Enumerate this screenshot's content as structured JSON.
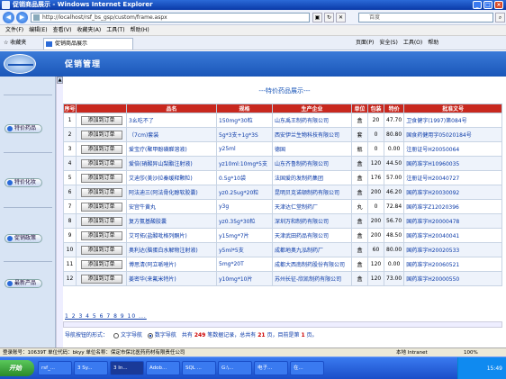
{
  "window": {
    "title": "促销商品展示 - Windows Internet Explorer"
  },
  "address": {
    "url": "http://localhost/rsf_bs_gsp/custom/frame.aspx",
    "search_placeholder": "百度"
  },
  "menu": [
    "文件(F)",
    "编辑(E)",
    "查看(V)",
    "收藏夹(A)",
    "工具(T)",
    "帮助(H)"
  ],
  "favbar": {
    "favorites": "收藏夹",
    "tab": "促销商品展示",
    "tools": [
      "页面(P)",
      "安全(S)",
      "工具(O)",
      "帮助"
    ]
  },
  "app": {
    "title": "促销管理"
  },
  "sidebar": [
    {
      "label": "特价药品"
    },
    {
      "label": "特价化妆"
    },
    {
      "label": "促销政策"
    },
    {
      "label": "最新产品"
    }
  ],
  "page": {
    "title": "---特价药品展示---"
  },
  "table": {
    "headers": [
      "序号",
      "",
      "品名",
      "规格",
      "生产企业",
      "单位",
      "包装",
      "特价",
      "批准文号"
    ],
    "order_label": "添加到订单",
    "rows": [
      {
        "no": "1",
        "name": "3幺吃不了",
        "spec": "150mg*30粒",
        "maker": "山东禹王制药有限公司",
        "unit": "盒",
        "pack": "20",
        "price": "47.70",
        "approval": "卫食健字(1997)第084号"
      },
      {
        "no": "2",
        "name": "（7cm)套装",
        "spec": "5g*3支+1g*3S",
        "maker": "西安伊兰生物科技有限公司",
        "unit": "套",
        "pack": "0",
        "price": "80.80",
        "approval": "国食药健用字05020184号"
      },
      {
        "no": "3",
        "name": "爱宝疗(聚甲酚磺醛溶液)",
        "spec": "y25ml",
        "maker": "德国",
        "unit": "瓶",
        "pack": "0",
        "price": "0.00",
        "approval": "注册证号H20050064"
      },
      {
        "no": "4",
        "name": "爱倍(硝酸异山梨酯注射液)",
        "spec": "yz10ml:10mg*5支",
        "maker": "山东齐鲁制药有限公司",
        "unit": "盒",
        "pack": "120",
        "price": "44.50",
        "approval": "国药准字H10960035"
      },
      {
        "no": "5",
        "name": "艾迪莎(美沙拉秦缓释颗粒)",
        "spec": "0.5g*10袋",
        "maker": "法国爱的发制药集团",
        "unit": "盒",
        "pack": "176",
        "price": "57.00",
        "approval": "注册证号H20040727"
      },
      {
        "no": "6",
        "name": "阿法迪三(阿法骨化醇软胶囊)",
        "spec": "yz0.25ug*20粒",
        "maker": "昆明贝克诺顿制药有限公司",
        "unit": "盒",
        "pack": "200",
        "price": "46.20",
        "approval": "国药准字H20030092"
      },
      {
        "no": "7",
        "name": "安宫牛黄丸",
        "spec": "y3g",
        "maker": "天津达仁堂制药厂",
        "unit": "丸",
        "pack": "0",
        "price": "72.84",
        "approval": "国药准字Z12020396"
      },
      {
        "no": "8",
        "name": "复方氨基酸胶囊",
        "spec": "yz0.35g*30粒",
        "maker": "深圳万和制药有限公司",
        "unit": "盒",
        "pack": "200",
        "price": "56.70",
        "approval": "国药准字H20000478"
      },
      {
        "no": "9",
        "name": "艾可拓(盐酸吡格列酮片)",
        "spec": "y15mg*7片",
        "maker": "天津武田药品有限公司",
        "unit": "盒",
        "pack": "200",
        "price": "48.50",
        "approval": "国药准字H20040041"
      },
      {
        "no": "10",
        "name": "奥利达(脑蛋白水解物注射液)",
        "spec": "y5ml*5支",
        "maker": "成都地奥九泓制药厂",
        "unit": "盒",
        "pack": "60",
        "price": "80.00",
        "approval": "国药准字H20020533"
      },
      {
        "no": "11",
        "name": "博思清(阿立哌唑片)",
        "spec": "5mg*20T",
        "maker": "成都大西南制药股份有限公司",
        "unit": "盒",
        "pack": "120",
        "price": "0.00",
        "approval": "国药准字H20060521"
      },
      {
        "no": "12",
        "name": "姜密华(来氟米特片)",
        "spec": "y10mg*10片",
        "maker": "苏州长征-欣凯制药有限公司",
        "unit": "盒",
        "pack": "120",
        "price": "73.00",
        "approval": "国药准字H20000550"
      }
    ]
  },
  "pager": {
    "links": "1 2 3 4 5 6 7 8 9 10 ..."
  },
  "footer": {
    "nav_prefix": "导航按钮的形式：",
    "opt_text": "文字导航",
    "opt_num": "数字导航",
    "total_prefix": "共有",
    "total": "249",
    "total_mid": "笔数据记录，总共有",
    "pages": "21",
    "pages_mid": "页，目前是第",
    "current": "1",
    "pages_suffix": "页。"
  },
  "status": {
    "left": "登录账号：10639T 单位代码：bkyy 单位名称：保定市保北医药药材有限责任公司",
    "zone": "本地 Intranet",
    "zoom": "100%"
  },
  "taskbar": {
    "start": "开始",
    "tasks": [
      "rsf_...",
      "3 Sy...",
      "3 In...",
      "Adob...",
      "SQL ...",
      "G:\\...",
      "电子...",
      "在..."
    ],
    "clock": "15:49"
  }
}
